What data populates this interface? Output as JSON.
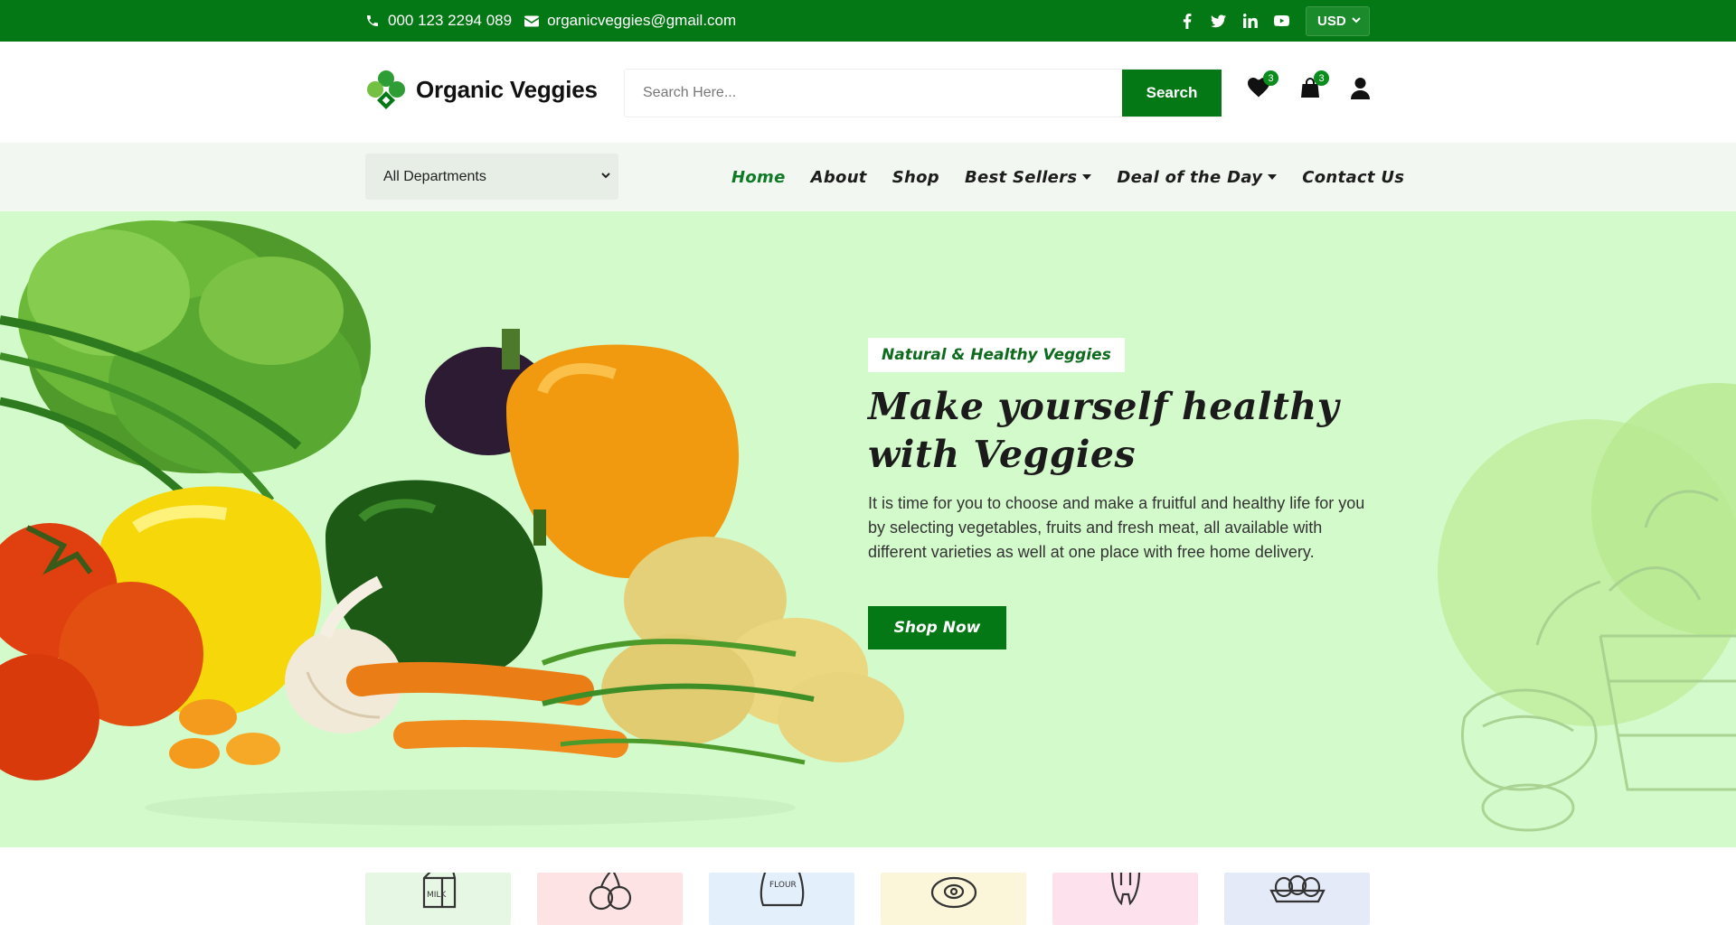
{
  "topbar": {
    "phone": "000 123 2294 089",
    "email": "organicveggies@gmail.com",
    "social_icons": [
      "facebook-icon",
      "twitter-icon",
      "linkedin-icon",
      "youtube-icon"
    ],
    "currency": "USD"
  },
  "header": {
    "brand": "Organic Veggies",
    "search_placeholder": "Search Here...",
    "search_button": "Search",
    "wishlist_count": "3",
    "cart_count": "3"
  },
  "nav": {
    "department_select": "All Departments",
    "items": [
      "Home",
      "About",
      "Shop",
      "Best Sellers",
      "Deal of the Day",
      "Contact Us"
    ],
    "active": "Home"
  },
  "hero": {
    "tag": "Natural & Healthy Veggies",
    "title": "Make yourself healthy with Veggies",
    "description": "It is time for you to choose and make a fruitful and healthy life for you by selecting vegetables, fruits and fresh meat, all available with different varieties as well at one place with free home delivery.",
    "cta": "Shop Now"
  },
  "categories": {
    "items": [
      {
        "icon": "milk-carton-icon",
        "label": "MILK",
        "color": "#e6f7e4"
      },
      {
        "icon": "cherry-icon",
        "color": "#fde3e3"
      },
      {
        "icon": "flour-bag-icon",
        "label": "FLOUR",
        "color": "#e3effb"
      },
      {
        "icon": "meat-icon",
        "color": "#fbf6d9"
      },
      {
        "icon": "tooth-icon",
        "color": "#fde2ee"
      },
      {
        "icon": "egg-tray-icon",
        "color": "#e4eaf8"
      }
    ]
  },
  "colors": {
    "brand_green": "#047815",
    "hero_bg": "#d3facb",
    "nav_bg": "#f2f8f1"
  }
}
